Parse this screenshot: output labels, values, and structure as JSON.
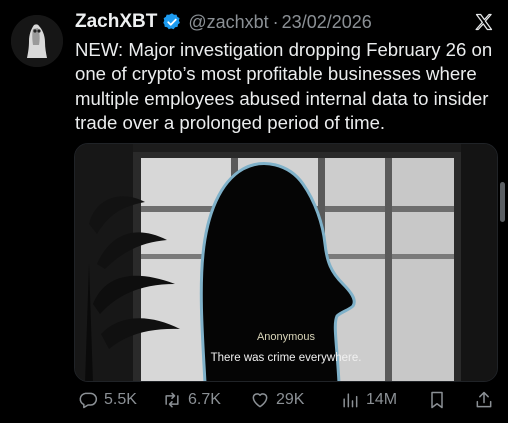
{
  "tweet": {
    "author_name": "ZachXBT",
    "handle": "@zachxbt",
    "separator": "·",
    "date": "23/02/2026",
    "text": "NEW: Major investigation dropping February 26 on one of crypto’s most profitable businesses where multiple employees abused internal data to insider trade over a prolonged period of time."
  },
  "media": {
    "caption_speaker": "Anonymous",
    "caption_text": "There was crime everywhere."
  },
  "actions": {
    "replies": "5.5K",
    "reposts": "6.7K",
    "likes": "29K",
    "views": "14M"
  },
  "icons": [
    "verified-badge-icon",
    "x-logo-icon",
    "reply-icon",
    "repost-icon",
    "like-icon",
    "views-icon",
    "bookmark-icon",
    "share-icon"
  ],
  "colors": {
    "verified": "#1d9bf0",
    "muted": "#8b9095",
    "text": "#e7e9ea",
    "background": "#000000"
  }
}
